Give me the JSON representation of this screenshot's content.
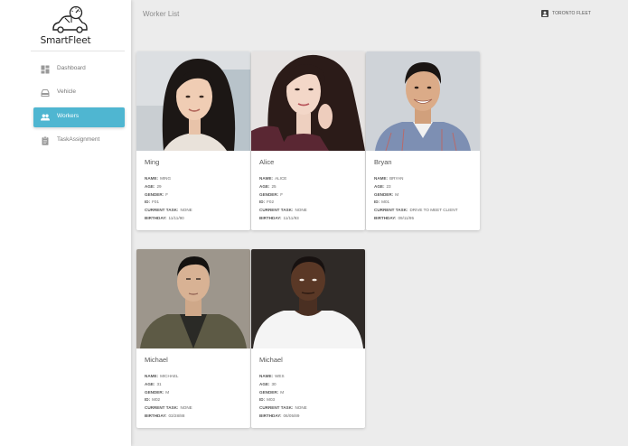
{
  "app": {
    "name": "SmartFleet"
  },
  "header": {
    "title": "Worker List",
    "org_icon": "account-box-icon",
    "org_name": "TORONTO FLEET"
  },
  "sidebar": {
    "items": [
      {
        "label": "Dashboard",
        "icon": "dashboard-icon",
        "active": false
      },
      {
        "label": "Vehicle",
        "icon": "car-icon",
        "active": false
      },
      {
        "label": "Workers",
        "icon": "people-icon",
        "active": true
      },
      {
        "label": "TaskAssignment",
        "icon": "clipboard-icon",
        "active": false
      }
    ]
  },
  "colors": {
    "accent": "#4fb6d1",
    "background": "#ececec",
    "card": "#ffffff"
  },
  "field_labels": {
    "name": "NAME:",
    "age": "AGE:",
    "gender": "GENDER:",
    "id": "ID:",
    "task": "CURRENT TASK:",
    "birthday": "BIRTHDAY:"
  },
  "workers": [
    {
      "display_name": "Ming",
      "name": "MING",
      "age": "29",
      "gender": "F",
      "id": "F01",
      "task": "NONE",
      "birthday": "11/11/90"
    },
    {
      "display_name": "Alice",
      "name": "ALICE",
      "age": "25",
      "gender": "F",
      "id": "F02",
      "task": "NONE",
      "birthday": "11/11/93"
    },
    {
      "display_name": "Bryan",
      "name": "BRYAN",
      "age": "23",
      "gender": "M",
      "id": "M01",
      "task": "DRIVE TO MEET CLIENT",
      "birthday": "09/11/95"
    },
    {
      "display_name": "Michael",
      "name": "MICHAEL",
      "age": "31",
      "gender": "M",
      "id": "M02",
      "task": "NONE",
      "birthday": "03/28/88"
    },
    {
      "display_name": "Michael",
      "name": "WES",
      "age": "30",
      "gender": "M",
      "id": "M03",
      "task": "NONE",
      "birthday": "06/05/89"
    }
  ]
}
